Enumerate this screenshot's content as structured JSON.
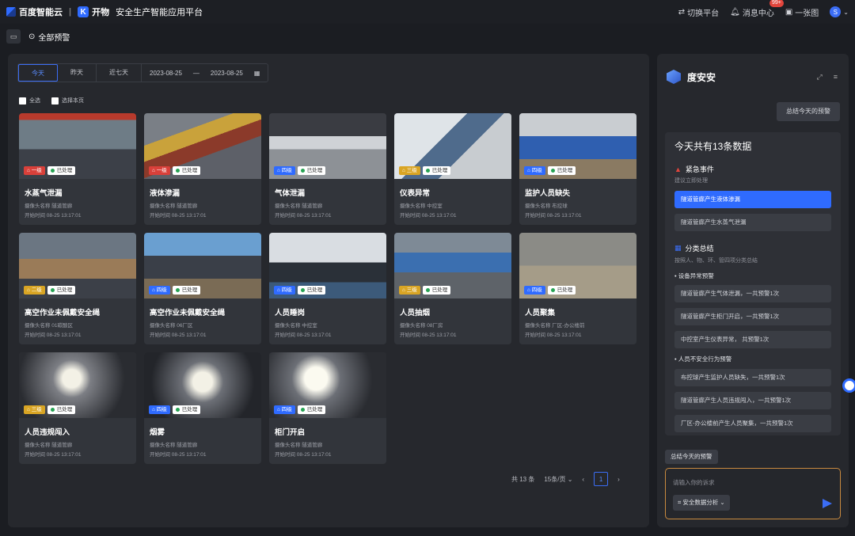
{
  "topbar": {
    "brand": "百度智能云",
    "divider": "|",
    "product_mark": "K",
    "product_name": "开物",
    "platform": "安全生产智能应用平台",
    "switch_label": "切换平台",
    "messages_label": "消息中心",
    "messages_badge": "99+",
    "screen_label": "一张图",
    "avatar_initial": "S"
  },
  "subbar": {
    "title": "全部预警"
  },
  "filters": {
    "tabs": [
      "今天",
      "昨天",
      "近七天"
    ],
    "active_tab": "今天",
    "date_start": "2023-08-25",
    "date_sep": "—",
    "date_end": "2023-08-25"
  },
  "checks": {
    "select_all": "全选",
    "select_page": "选择本页"
  },
  "cards": [
    {
      "title": "水蒸气泄漏",
      "level": "一级",
      "level_color": "red",
      "status": "已处理",
      "camera": "摄像头名称  隧道管廊",
      "time": "开始时间  08-25 13:17:01"
    },
    {
      "title": "液体渗漏",
      "level": "一级",
      "level_color": "red",
      "status": "已处理",
      "camera": "摄像头名称  隧道管廊",
      "time": "开始时间  08-25 13:17:01"
    },
    {
      "title": "气体泄漏",
      "level": "四级",
      "level_color": "blue",
      "status": "已处理",
      "camera": "摄像头名称  隧道管廊",
      "time": "开始时间  08-25 13:17:01"
    },
    {
      "title": "仪表异常",
      "level": "三级",
      "level_color": "yellow",
      "status": "已处理",
      "camera": "摄像头名称  中控室",
      "time": "开始时间  08-25 13:17:01"
    },
    {
      "title": "监护人员缺失",
      "level": "四级",
      "level_color": "blue",
      "status": "已处理",
      "camera": "摄像头名称  布控球",
      "time": "开始时间  08-25 13:17:01"
    },
    {
      "title": "高空作业未佩戴安全绳",
      "level": "二级",
      "level_color": "yellow",
      "status": "已处理",
      "camera": "摄像头名称  01碳酸区",
      "time": "开始时间  08-25 13:17:01"
    },
    {
      "title": "高空作业未佩戴安全绳",
      "level": "四级",
      "level_color": "blue",
      "status": "已处理",
      "camera": "摄像头名称  06厂区",
      "time": "开始时间  08-25 13:17:01"
    },
    {
      "title": "人员睡岗",
      "level": "四级",
      "level_color": "blue",
      "status": "已处理",
      "camera": "摄像头名称  中控室",
      "time": "开始时间  08-25 13:17:01"
    },
    {
      "title": "人员抽烟",
      "level": "三级",
      "level_color": "yellow",
      "status": "已处理",
      "camera": "摄像头名称  08厂房",
      "time": "开始时间  08-25 13:17:01"
    },
    {
      "title": "人员聚集",
      "level": "四级",
      "level_color": "blue",
      "status": "已处理",
      "camera": "摄像头名称  厂区-办公楼前",
      "time": "开始时间  08-25 13:17:01"
    },
    {
      "title": "人员违规闯入",
      "level": "三级",
      "level_color": "yellow",
      "status": "已处理",
      "camera": "摄像头名称  隧道管廊",
      "time": "开始时间  08-25 13:17:01"
    },
    {
      "title": "烟雾",
      "level": "四级",
      "level_color": "blue",
      "status": "已处理",
      "camera": "摄像头名称  隧道管廊",
      "time": "开始时间  08-25 13:17:01"
    },
    {
      "title": "柜门开启",
      "level": "四级",
      "level_color": "blue",
      "status": "已处理",
      "camera": "摄像头名称  隧道管廊",
      "time": "开始时间  08-25 13:17:01"
    }
  ],
  "pager": {
    "total": "共 13 条",
    "page_size": "15条/页",
    "current": "1"
  },
  "assistant": {
    "name": "度安安",
    "summarize_today_btn": "总结今天的预警",
    "headline": "今天共有13条数据",
    "urgent_title": "紧急事件",
    "urgent_sub": "建议立即处理",
    "urgent_items": [
      "隧道管廊产生液体渗漏",
      "隧道管廊产生水蒸气泄漏"
    ],
    "category_title": "分类总结",
    "category_sub": "按照人、物、环、管四项分类总结",
    "device_heading": "设备异常预警",
    "device_items": [
      "隧道管廊产生气体泄漏，一共预警1次",
      "隧道管廊产生柜门开启，一共预警1次",
      "中控室产生仪表异常，    共预警1次"
    ],
    "people_heading": "人员不安全行为预警",
    "people_items": [
      "布控球产生监护人员缺失，一共预警1次",
      "隧道管廊产生人员违规闯入，一共预警1次",
      "厂区-办公楼前产生人员聚集，一共预警1次"
    ],
    "chip": "总结今天的预警",
    "input_placeholder": "请输入你的诉求",
    "mode_select": "安全数据分析"
  }
}
